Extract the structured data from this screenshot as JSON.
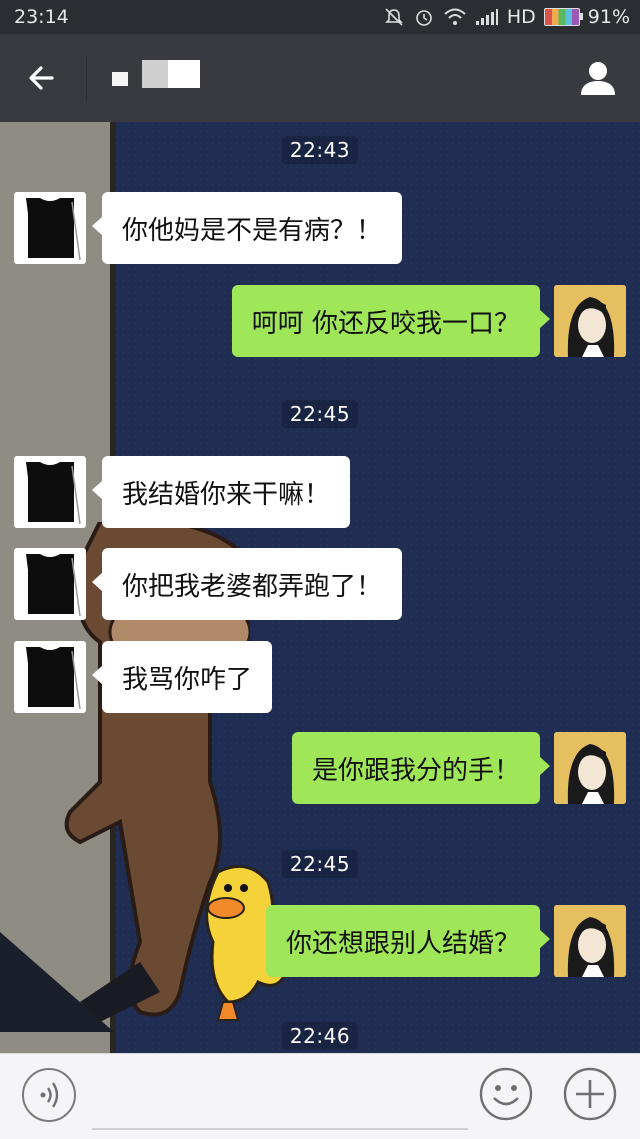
{
  "status_bar": {
    "time": "23:14",
    "network": "HD",
    "battery": "91%",
    "icons": [
      "mute-icon",
      "alarm-icon",
      "wifi-icon",
      "signal-icon",
      "battery-icon"
    ]
  },
  "header": {
    "back_icon": "back-arrow-icon",
    "profile_icon": "person-icon"
  },
  "messages": [
    {
      "type": "time",
      "text": "22:43"
    },
    {
      "type": "msg",
      "side": "left",
      "text": "你他妈是不是有病？！"
    },
    {
      "type": "msg",
      "side": "right",
      "text": "呵呵 你还反咬我一口？"
    },
    {
      "type": "time",
      "text": "22:45"
    },
    {
      "type": "msg",
      "side": "left",
      "text": "我结婚你来干嘛！"
    },
    {
      "type": "msg",
      "side": "left",
      "text": "你把我老婆都弄跑了！"
    },
    {
      "type": "msg",
      "side": "left",
      "text": "我骂你咋了"
    },
    {
      "type": "msg",
      "side": "right",
      "text": "是你跟我分的手！"
    },
    {
      "type": "time",
      "text": "22:45"
    },
    {
      "type": "msg",
      "side": "right",
      "text": "你还想跟别人结婚？"
    },
    {
      "type": "time",
      "text": "22:46"
    }
  ],
  "input_bar": {
    "voice_icon": "voice-icon",
    "emoji_icon": "emoji-icon",
    "plus_icon": "plus-icon",
    "input_value": ""
  },
  "colors": {
    "chat_background": "#1f2d52",
    "sent_bubble": "#9fe658",
    "received_bubble": "#ffffff",
    "title_bar": "#393a3f"
  }
}
